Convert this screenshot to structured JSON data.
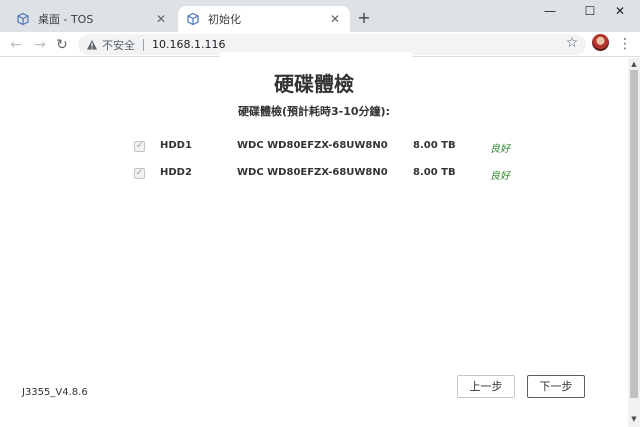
{
  "browser": {
    "tabs": [
      {
        "title": "桌面 - TOS",
        "icon": "cube-icon",
        "active": false
      },
      {
        "title": "初始化",
        "icon": "cube-icon",
        "active": true
      }
    ],
    "new_tab_label": "+",
    "window_controls": {
      "minimize": "—",
      "maximize": "☐",
      "close": "✕"
    },
    "nav": {
      "back": "←",
      "forward": "→",
      "reload": "↻"
    },
    "omnibox": {
      "security_text": "不安全",
      "url": "10.168.1.116"
    },
    "star": "☆",
    "menu": "⋮"
  },
  "page": {
    "title": "硬碟體檢",
    "subtitle": "硬碟體檢(預計耗時3-10分鐘):",
    "disks": [
      {
        "name": "HDD1",
        "model": "WDC WD80EFZX-68UW8N0",
        "size": "8.00 TB",
        "status": "良好",
        "checked": true
      },
      {
        "name": "HDD2",
        "model": "WDC WD80EFZX-68UW8N0",
        "size": "8.00 TB",
        "status": "良好",
        "checked": true
      }
    ],
    "version": "J3355_V4.8.6",
    "buttons": {
      "prev": "上一步",
      "next": "下一步"
    },
    "status_color": "#2e8b2e"
  },
  "scrollbar": {
    "up": "▲",
    "down": "▼"
  }
}
